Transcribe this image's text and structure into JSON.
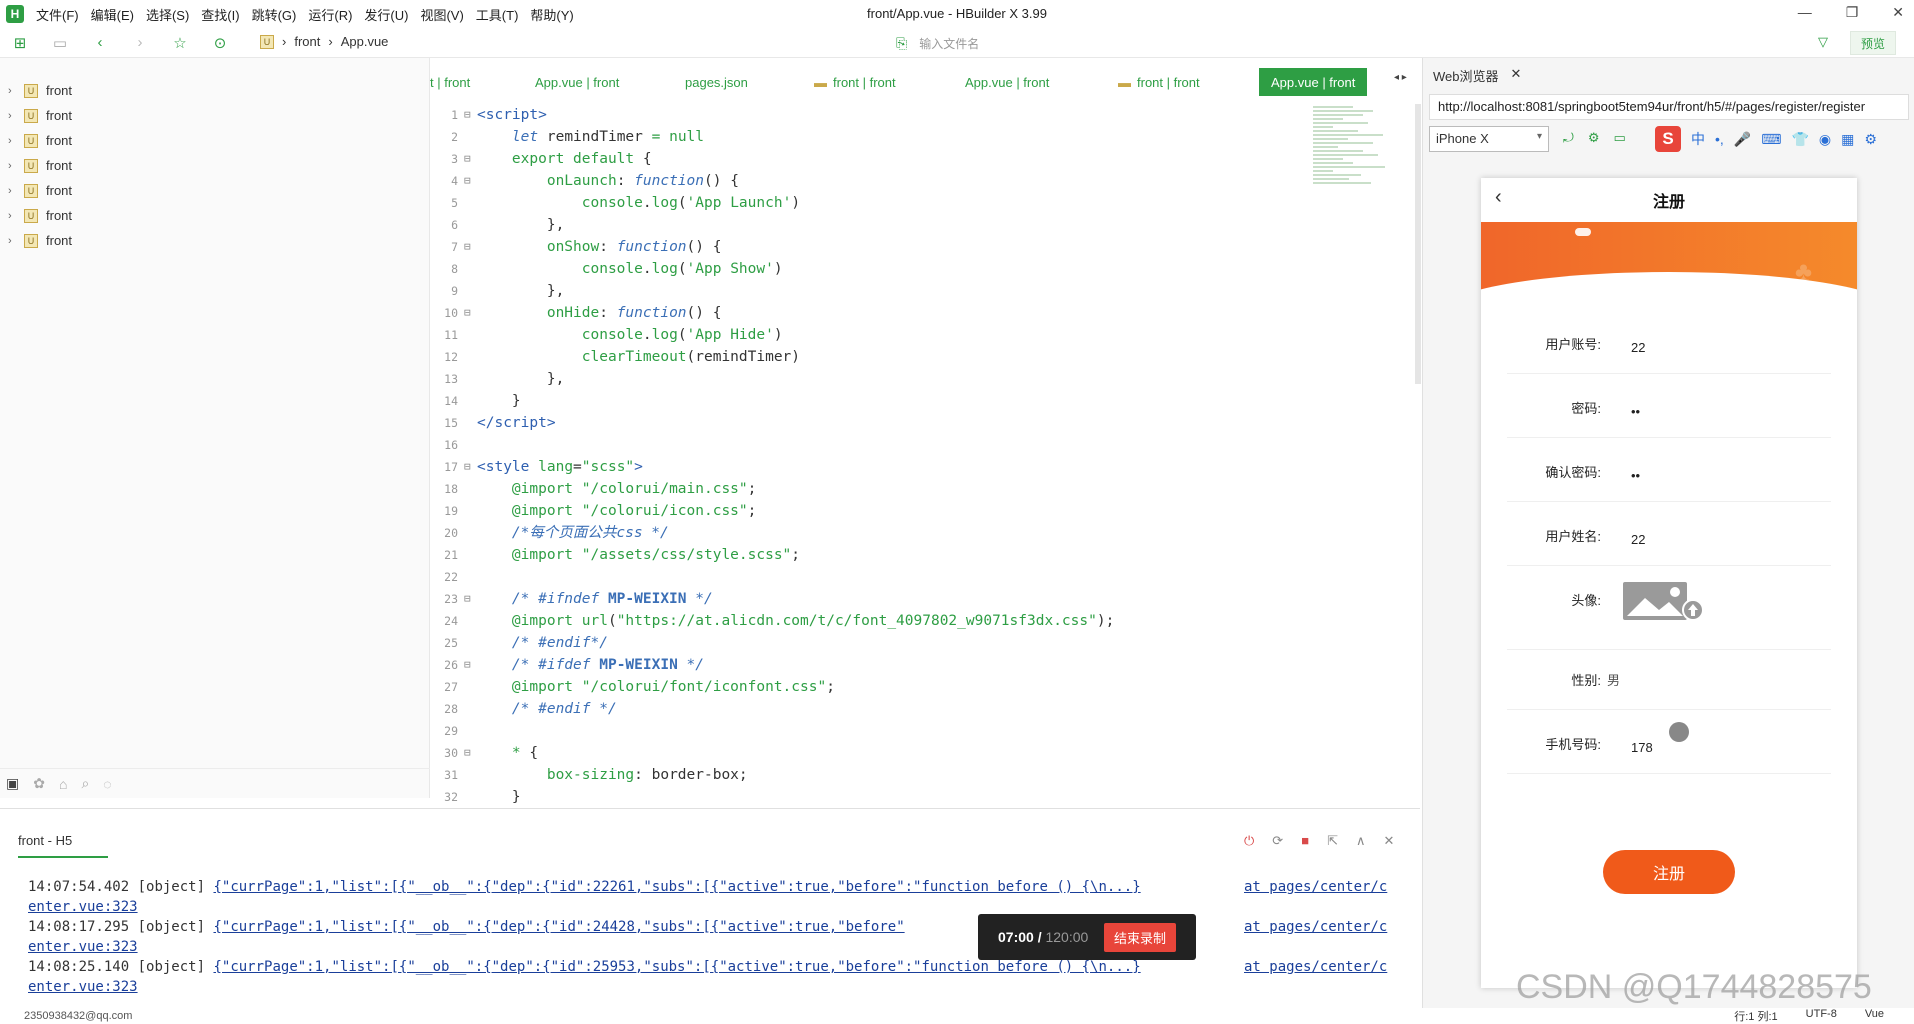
{
  "app": {
    "logo": "H",
    "title": "front/App.vue - HBuilder X 3.99",
    "menu": [
      "文件(F)",
      "编辑(E)",
      "选择(S)",
      "查找(I)",
      "跳转(G)",
      "运行(R)",
      "发行(U)",
      "视图(V)",
      "工具(T)",
      "帮助(Y)"
    ],
    "window_controls": [
      "—",
      "❐",
      "✕"
    ]
  },
  "toolbar": {
    "breadcrumb": [
      "front",
      "App.vue"
    ],
    "file_search_placeholder": "输入文件名",
    "preview_label": "预览"
  },
  "sidebar": {
    "items": [
      "front",
      "front",
      "front",
      "front",
      "front",
      "front",
      "front"
    ]
  },
  "editor_tabs": [
    {
      "label": "t | front",
      "folder": false,
      "active": false
    },
    {
      "label": "App.vue | front",
      "folder": false,
      "active": false
    },
    {
      "label": "pages.json",
      "folder": false,
      "active": false
    },
    {
      "label": "front | front",
      "folder": true,
      "active": false
    },
    {
      "label": "App.vue | front",
      "folder": false,
      "active": false
    },
    {
      "label": "front | front",
      "folder": true,
      "active": false
    },
    {
      "label": "App.vue | front",
      "folder": false,
      "active": true
    }
  ],
  "code_lines": [
    {
      "n": "1",
      "fold": "⊟",
      "html": "<span class='tag'>&lt;script&gt;</span>"
    },
    {
      "n": "2",
      "fold": "",
      "html": "    <span class='it'>let</span> remindTimer <span class='kw'>=</span> <span class='kw'>null</span>"
    },
    {
      "n": "3",
      "fold": "⊟",
      "html": "    <span class='kw'>export default</span> {"
    },
    {
      "n": "4",
      "fold": "⊟",
      "html": "        <span class='fn'>onLaunch</span>: <span class='it'>function</span>() {"
    },
    {
      "n": "5",
      "fold": "",
      "html": "            <span class='fn'>console</span>.<span class='fn'>log</span>(<span class='str'>'App Launch'</span>)"
    },
    {
      "n": "6",
      "fold": "",
      "html": "        },"
    },
    {
      "n": "7",
      "fold": "⊟",
      "html": "        <span class='fn'>onShow</span>: <span class='it'>function</span>() {"
    },
    {
      "n": "8",
      "fold": "",
      "html": "            <span class='fn'>console</span>.<span class='fn'>log</span>(<span class='str'>'App Show'</span>)"
    },
    {
      "n": "9",
      "fold": "",
      "html": "        },"
    },
    {
      "n": "10",
      "fold": "⊟",
      "html": "        <span class='fn'>onHide</span>: <span class='it'>function</span>() {"
    },
    {
      "n": "11",
      "fold": "",
      "html": "            <span class='fn'>console</span>.<span class='fn'>log</span>(<span class='str'>'App Hide'</span>)"
    },
    {
      "n": "12",
      "fold": "",
      "html": "            <span class='fn'>clearTimeout</span>(remindTimer)"
    },
    {
      "n": "13",
      "fold": "",
      "html": "        },"
    },
    {
      "n": "14",
      "fold": "",
      "html": "    }"
    },
    {
      "n": "15",
      "fold": "",
      "html": "<span class='tag'>&lt;/script&gt;</span>"
    },
    {
      "n": "16",
      "fold": "",
      "html": ""
    },
    {
      "n": "17",
      "fold": "⊟",
      "html": "<span class='tag'>&lt;style</span> <span class='fn'>lang</span>=<span class='str'>\"scss\"</span><span class='tag'>&gt;</span>"
    },
    {
      "n": "18",
      "fold": "",
      "html": "    <span class='kw'>@import</span> <span class='str'>\"/colorui/main.css\"</span>;"
    },
    {
      "n": "19",
      "fold": "",
      "html": "    <span class='kw'>@import</span> <span class='str'>\"/colorui/icon.css\"</span>;"
    },
    {
      "n": "20",
      "fold": "",
      "html": "    <span class='cmt'>/*每个页面公共css */</span>"
    },
    {
      "n": "21",
      "fold": "",
      "html": "    <span class='kw'>@import</span> <span class='str'>\"/assets/css/style.scss\"</span>;"
    },
    {
      "n": "22",
      "fold": "",
      "html": ""
    },
    {
      "n": "23",
      "fold": "⊟",
      "html": "    <span class='cmt'>/* #ifndef <span class='bold'>MP-WEIXIN</span> */</span>"
    },
    {
      "n": "24",
      "fold": "",
      "html": "    <span class='kw'>@import</span> <span class='fn'>url</span>(<span class='str'>\"https://at.alicdn.com/t/c/font_4097802_w9071sf3dx.css\"</span>);"
    },
    {
      "n": "25",
      "fold": "",
      "html": "    <span class='cmt'>/* #endif*/</span>"
    },
    {
      "n": "26",
      "fold": "⊟",
      "html": "    <span class='cmt'>/* #ifdef <span class='bold'>MP-WEIXIN</span> */</span>"
    },
    {
      "n": "27",
      "fold": "",
      "html": "    <span class='kw'>@import</span> <span class='str'>\"/colorui/font/iconfont.css\"</span>;"
    },
    {
      "n": "28",
      "fold": "",
      "html": "    <span class='cmt'>/* #endif */</span>"
    },
    {
      "n": "29",
      "fold": "",
      "html": ""
    },
    {
      "n": "30",
      "fold": "⊟",
      "html": "    <span class='kw'>*</span> {"
    },
    {
      "n": "31",
      "fold": "",
      "html": "        <span class='fn'>box-sizing</span>: border-box;"
    },
    {
      "n": "32",
      "fold": "",
      "html": "    }"
    }
  ],
  "console": {
    "tab_label": "front - H5",
    "logs": [
      {
        "time": "14:07:54.402",
        "type": "[object]",
        "text": "{\"currPage\":1,\"list\":[{\"__ob__\":{\"dep\":{\"id\":22261,\"subs\":[{\"active\":true,\"before\":\"function before () {\\n...}",
        "source": "at pages/center/c",
        "source2": "enter.vue:323"
      },
      {
        "time": "14:08:17.295",
        "type": "[object]",
        "text": "{\"currPage\":1,\"list\":[{\"__ob__\":{\"dep\":{\"id\":24428,\"subs\":[{\"active\":true,\"before\"",
        "source": "at pages/center/c",
        "source2": "enter.vue:323"
      },
      {
        "time": "14:08:25.140",
        "type": "[object]",
        "text": "{\"currPage\":1,\"list\":[{\"__ob__\":{\"dep\":{\"id\":25953,\"subs\":[{\"active\":true,\"before\":\"function before () {\\n...}",
        "source": "at pages/center/c",
        "source2": "enter.vue:323"
      }
    ]
  },
  "recorder": {
    "elapsed": "07:00 /",
    "total": "120:00",
    "stop_label": "结束录制"
  },
  "statusbar": {
    "account": "2350938432@qq.com",
    "position": "行:1  列:1",
    "encoding": "UTF-8",
    "lang": "Vue"
  },
  "browser": {
    "tab_label": "Web浏览器",
    "url": "http://localhost:8081/springboot5tem94ur/front/h5/#/pages/register/register",
    "device": "iPhone X",
    "ime_logo": "S",
    "ime_items": [
      "中",
      "•,",
      "🎤",
      "⌨",
      "👕",
      "◉",
      "▦",
      "⚙"
    ]
  },
  "phone": {
    "title": "注册",
    "fields": [
      {
        "label": "用户账号:",
        "value": "22"
      },
      {
        "label": "密码:",
        "value": "••"
      },
      {
        "label": "确认密码:",
        "value": "••"
      },
      {
        "label": "用户姓名:",
        "value": "22"
      },
      {
        "label": "头像:",
        "value": ""
      },
      {
        "label": "性别:",
        "value": "男"
      },
      {
        "label": "手机号码:",
        "value": "178"
      }
    ],
    "submit_label": "注册"
  },
  "watermark": "CSDN @Q1744828575",
  "colors": {
    "accent": "#2e9e44",
    "orange": "#f05a1a"
  }
}
